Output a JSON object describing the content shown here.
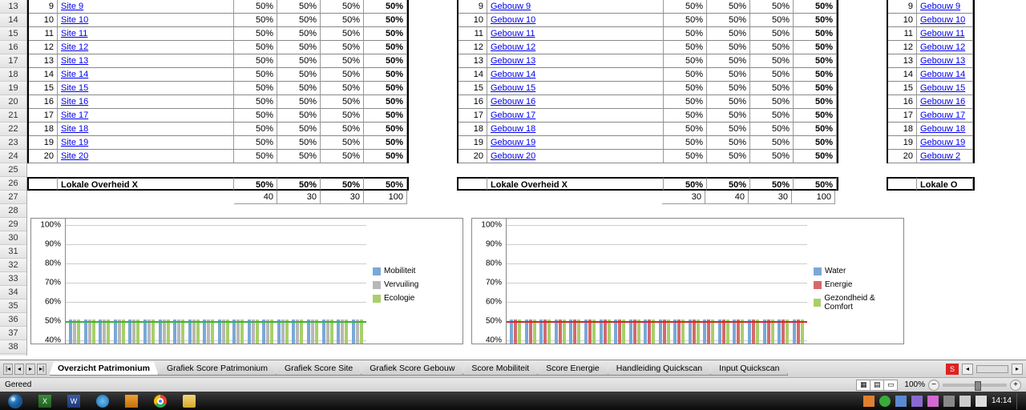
{
  "rows_start": 13,
  "rows_end": 38,
  "table1": {
    "prefix": "Site",
    "link_prefix": "Site ",
    "start_idx": 9,
    "end_idx": 20,
    "cols_pct": [
      "50%",
      "50%",
      "50%",
      "50%"
    ],
    "summary_label": "Lokale Overheid X",
    "summary_pcts": [
      "50%",
      "50%",
      "50%",
      "50%"
    ],
    "summary_nums": [
      "40",
      "30",
      "30",
      "100"
    ]
  },
  "table2": {
    "prefix": "Gebouw",
    "link_prefix": "Gebouw ",
    "start_idx": 9,
    "end_idx": 20,
    "cols_pct": [
      "50%",
      "50%",
      "50%",
      "50%"
    ],
    "summary_label": "Lokale Overheid X",
    "summary_pcts": [
      "50%",
      "50%",
      "50%",
      "50%"
    ],
    "summary_nums": [
      "30",
      "40",
      "30",
      "100"
    ]
  },
  "table3": {
    "prefix": "Gebouw",
    "link_prefix": "Gebouw ",
    "alt_last": "Gebouw 2",
    "start_idx": 9,
    "end_idx": 20,
    "summary_label": "Lokale O"
  },
  "chart_data": [
    {
      "type": "bar",
      "ylim": [
        0,
        100
      ],
      "yticks": [
        "100%",
        "90%",
        "80%",
        "70%",
        "60%",
        "50%",
        "40%"
      ],
      "categories_count": 20,
      "series": [
        {
          "name": "Mobiliteit",
          "color": "#7aa8d8",
          "values": [
            50,
            50,
            50,
            50,
            50,
            50,
            50,
            50,
            50,
            50,
            50,
            50,
            50,
            50,
            50,
            50,
            50,
            50,
            50,
            50
          ]
        },
        {
          "name": "Vervuiling",
          "color": "#b8b8b8",
          "values": [
            50,
            50,
            50,
            50,
            50,
            50,
            50,
            50,
            50,
            50,
            50,
            50,
            50,
            50,
            50,
            50,
            50,
            50,
            50,
            50
          ]
        },
        {
          "name": "Ecologie",
          "color": "#a8cf6a",
          "values": [
            50,
            50,
            50,
            50,
            50,
            50,
            50,
            50,
            50,
            50,
            50,
            50,
            50,
            50,
            50,
            50,
            50,
            50,
            50,
            50
          ]
        }
      ],
      "topline_color": "#3cb043",
      "topline_value": 50
    },
    {
      "type": "bar",
      "ylim": [
        0,
        100
      ],
      "yticks": [
        "100%",
        "90%",
        "80%",
        "70%",
        "60%",
        "50%",
        "40%"
      ],
      "categories_count": 20,
      "series": [
        {
          "name": "Water",
          "color": "#7aa8d8",
          "values": [
            50,
            50,
            50,
            50,
            50,
            50,
            50,
            50,
            50,
            50,
            50,
            50,
            50,
            50,
            50,
            50,
            50,
            50,
            50,
            50
          ]
        },
        {
          "name": "Energie",
          "color": "#d46a6a",
          "values": [
            50,
            50,
            50,
            50,
            50,
            50,
            50,
            50,
            50,
            50,
            50,
            50,
            50,
            50,
            50,
            50,
            50,
            50,
            50,
            50
          ]
        },
        {
          "name": "Gezondheid & Comfort",
          "color": "#a8cf6a",
          "values": [
            50,
            50,
            50,
            50,
            50,
            50,
            50,
            50,
            50,
            50,
            50,
            50,
            50,
            50,
            50,
            50,
            50,
            50,
            50,
            50
          ]
        }
      ],
      "topline_color": "#cc2a2a",
      "topline_value": 50
    }
  ],
  "tabs": [
    "Overzicht Patrimonium",
    "Grafiek Score Patrimonium",
    "Grafiek Score Site",
    "Grafiek Score Gebouw",
    "Score Mobiliteit",
    "Score Energie",
    "Handleiding Quickscan",
    "Input Quickscan"
  ],
  "active_tab": 0,
  "status_left": "Gereed",
  "zoom_label": "100%",
  "clock": "14:14"
}
